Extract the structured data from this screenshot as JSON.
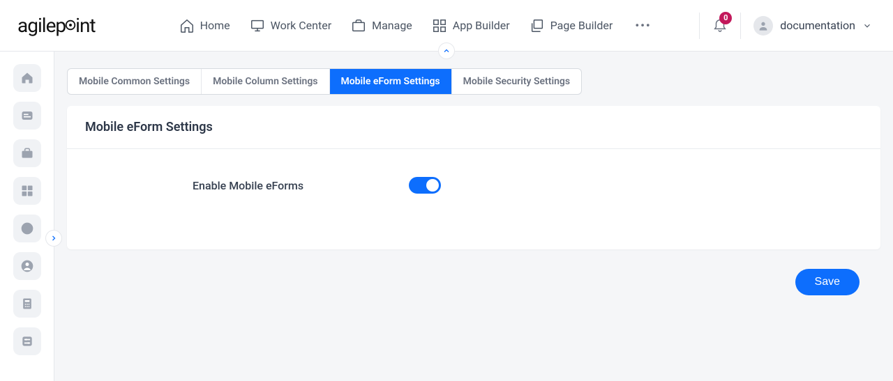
{
  "header": {
    "logo_text": "agilepoint",
    "nav": [
      {
        "label": "Home"
      },
      {
        "label": "Work Center"
      },
      {
        "label": "Manage"
      },
      {
        "label": "App Builder"
      },
      {
        "label": "Page Builder"
      }
    ],
    "notification_count": "0",
    "user_name": "documentation"
  },
  "tabs": [
    {
      "label": "Mobile Common Settings",
      "active": false
    },
    {
      "label": "Mobile Column Settings",
      "active": false
    },
    {
      "label": "Mobile eForm Settings",
      "active": true
    },
    {
      "label": "Mobile Security Settings",
      "active": false
    }
  ],
  "panel": {
    "title": "Mobile eForm Settings",
    "setting_label": "Enable Mobile eForms",
    "toggle_on": true
  },
  "actions": {
    "save_label": "Save"
  }
}
